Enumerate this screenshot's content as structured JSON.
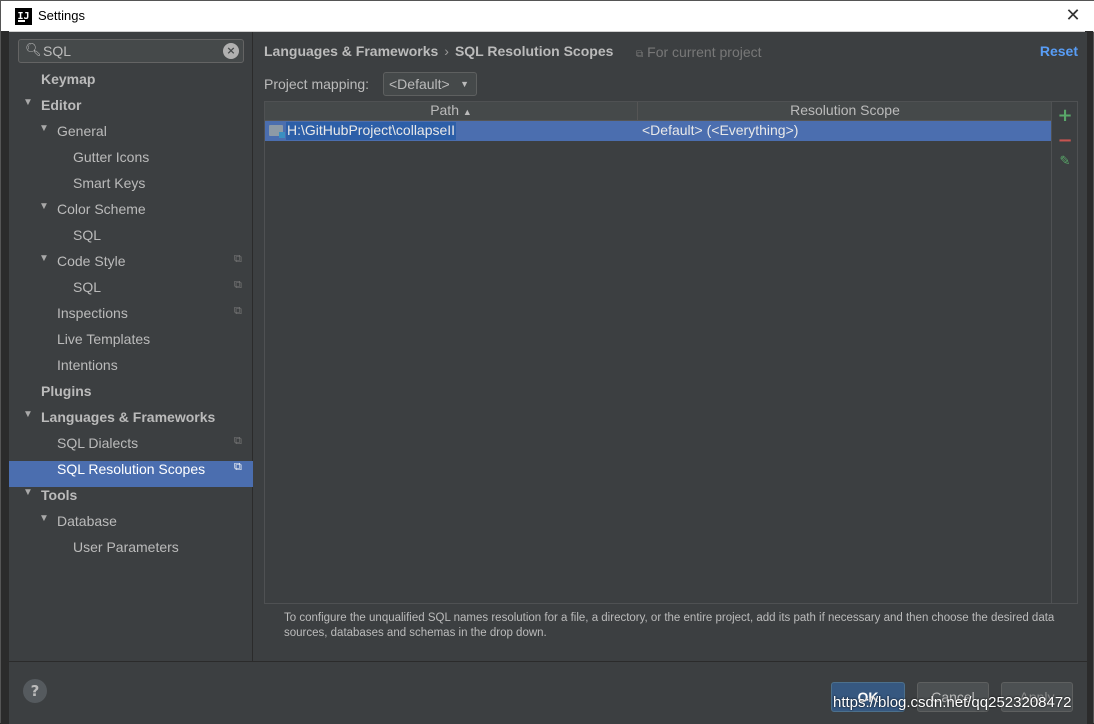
{
  "window": {
    "title": "Settings",
    "app_icon": "intellij-idea-icon"
  },
  "search": {
    "value": "SQL"
  },
  "tree": [
    {
      "label": "Keymap",
      "level": 0,
      "bold": true,
      "expanded": null,
      "project": false,
      "selected": false
    },
    {
      "label": "Editor",
      "level": 0,
      "bold": true,
      "expanded": true,
      "project": false,
      "selected": false
    },
    {
      "label": "General",
      "level": 1,
      "bold": false,
      "expanded": true,
      "project": false,
      "selected": false
    },
    {
      "label": "Gutter Icons",
      "level": 2,
      "bold": false,
      "expanded": null,
      "project": false,
      "selected": false
    },
    {
      "label": "Smart Keys",
      "level": 2,
      "bold": false,
      "expanded": null,
      "project": false,
      "selected": false
    },
    {
      "label": "Color Scheme",
      "level": 1,
      "bold": false,
      "expanded": true,
      "project": false,
      "selected": false
    },
    {
      "label": "SQL",
      "level": 2,
      "bold": false,
      "expanded": null,
      "project": false,
      "selected": false
    },
    {
      "label": "Code Style",
      "level": 1,
      "bold": false,
      "expanded": true,
      "project": true,
      "selected": false
    },
    {
      "label": "SQL",
      "level": 2,
      "bold": false,
      "expanded": null,
      "project": true,
      "selected": false
    },
    {
      "label": "Inspections",
      "level": 1,
      "bold": false,
      "expanded": null,
      "project": true,
      "selected": false
    },
    {
      "label": "Live Templates",
      "level": 1,
      "bold": false,
      "expanded": null,
      "project": false,
      "selected": false
    },
    {
      "label": "Intentions",
      "level": 1,
      "bold": false,
      "expanded": null,
      "project": false,
      "selected": false
    },
    {
      "label": "Plugins",
      "level": 0,
      "bold": true,
      "expanded": null,
      "project": false,
      "selected": false
    },
    {
      "label": "Languages & Frameworks",
      "level": 0,
      "bold": true,
      "expanded": true,
      "project": false,
      "selected": false
    },
    {
      "label": "SQL Dialects",
      "level": 1,
      "bold": false,
      "expanded": null,
      "project": true,
      "selected": false
    },
    {
      "label": "SQL Resolution Scopes",
      "level": 1,
      "bold": false,
      "expanded": null,
      "project": true,
      "selected": true
    },
    {
      "label": "Tools",
      "level": 0,
      "bold": true,
      "expanded": true,
      "project": false,
      "selected": false
    },
    {
      "label": "Database",
      "level": 1,
      "bold": false,
      "expanded": true,
      "project": false,
      "selected": false
    },
    {
      "label": "User Parameters",
      "level": 2,
      "bold": false,
      "expanded": null,
      "project": false,
      "selected": false
    }
  ],
  "breadcrumb": {
    "parent": "Languages & Frameworks",
    "separator": "›",
    "current": "SQL Resolution Scopes"
  },
  "for_project": {
    "icon": "project-copy-icon",
    "label": "For current project"
  },
  "reset_label": "Reset",
  "mapping": {
    "label": "Project mapping:",
    "value": "<Default>"
  },
  "table": {
    "columns": [
      {
        "label": "Path",
        "sort": "▲"
      },
      {
        "label": "Resolution Scope"
      }
    ],
    "rows": [
      {
        "path": "H:\\GitHubProject\\collapseII",
        "scope": "<Default> (<Everything>)"
      }
    ]
  },
  "toolbar": {
    "add": "+",
    "remove": "−",
    "edit": "✎"
  },
  "hint": "To configure the unqualified SQL names resolution for a file, a directory, or the entire project, add its path if necessary and then choose the desired data sources, databases and schemas in the drop down.",
  "footer": {
    "help": "?",
    "ok": "OK",
    "cancel": "Cancel",
    "apply": "Apply"
  },
  "watermark": "https://blog.csdn.net/qq2523208472",
  "colors": {
    "selection": "#4b6eaf",
    "link": "#589df6",
    "add": "#59a869",
    "remove": "#c75450",
    "background": "#3c3f41"
  }
}
